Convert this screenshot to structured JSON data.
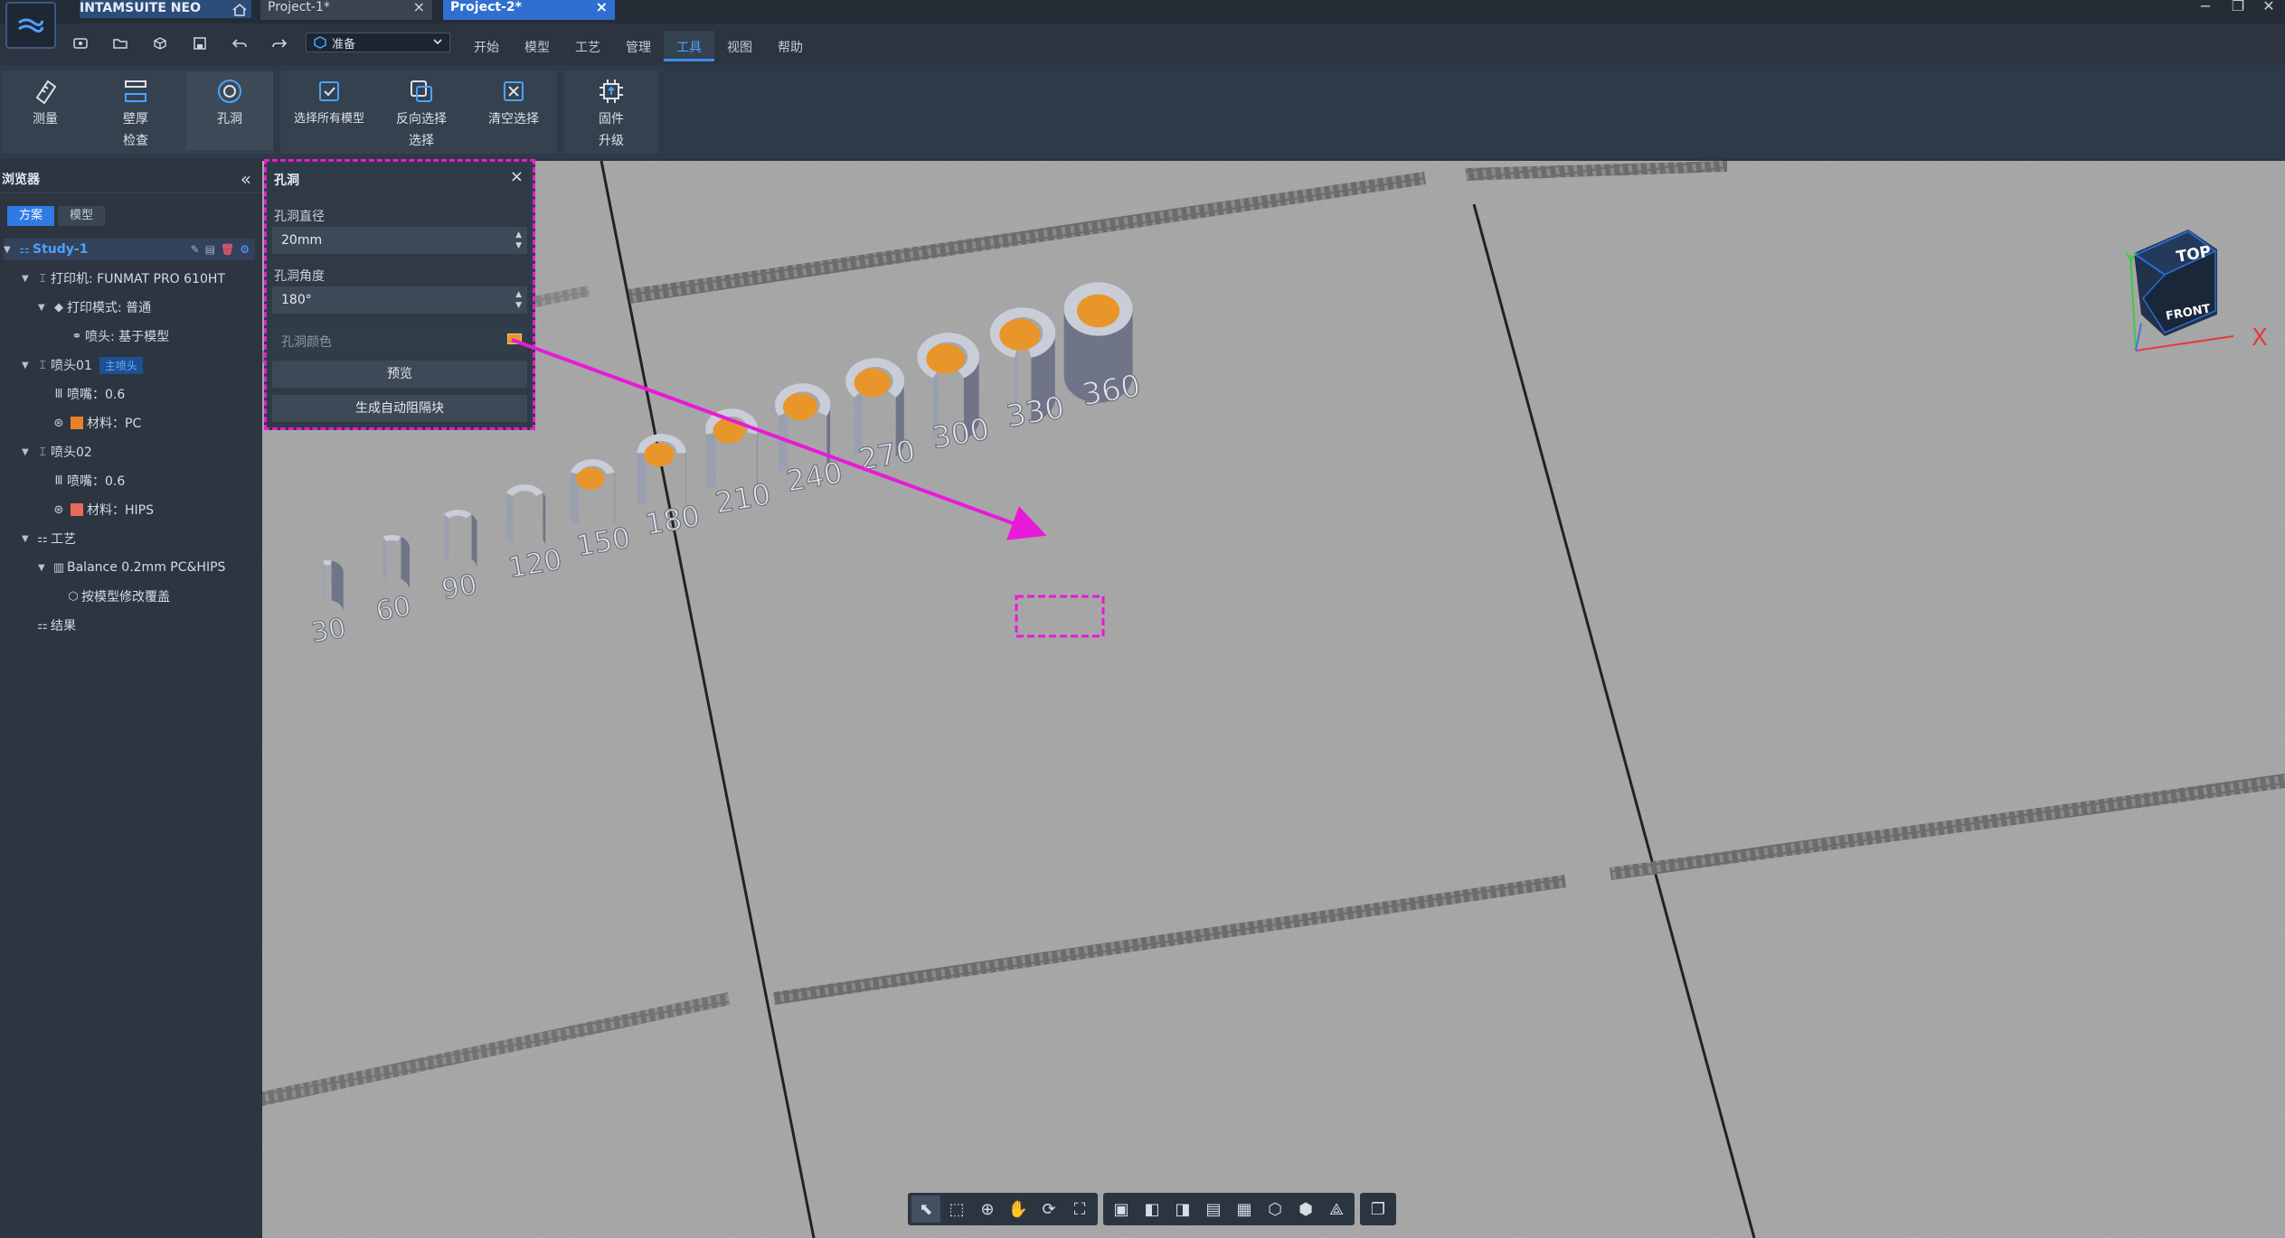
{
  "app": {
    "name": "INTAMSUITE NEO",
    "tabs": [
      {
        "label": "Project-1*",
        "active": false
      },
      {
        "label": "Project-2*",
        "active": true
      }
    ],
    "close_glyph": "×",
    "window_controls": [
      "−",
      "❐",
      "✕"
    ]
  },
  "quickbar": {
    "mode": "准备"
  },
  "menu": {
    "items": [
      "开始",
      "模型",
      "工艺",
      "管理",
      "工具",
      "视图",
      "帮助"
    ],
    "active": "工具"
  },
  "ribbon": {
    "buttons": [
      {
        "label": "测量",
        "icon": "measure-icon"
      },
      {
        "label": "壁厚\n检查",
        "icon": "wall-thickness-icon"
      },
      {
        "label": "孔洞",
        "icon": "hole-icon",
        "active": true
      },
      {
        "label": "选择所有模型",
        "icon": "select-all-icon"
      },
      {
        "label": "反向选择\n选择",
        "icon": "invert-selection-icon"
      },
      {
        "label": "清空选择",
        "icon": "clear-selection-icon"
      },
      {
        "label": "固件\n升级",
        "icon": "firmware-upgrade-icon"
      }
    ]
  },
  "sidebar": {
    "title": "浏览器",
    "tabs": [
      "方案",
      "模型"
    ],
    "active_tab": "方案",
    "tree": {
      "study": "Study-1",
      "printer": "打印机: FUNMAT PRO 610HT",
      "print_mode": "打印模式: 普通",
      "nozzle_head": "喷头: 基于模型",
      "head1": "喷头01",
      "head1_badge": "主喷头",
      "head1_nozzle": "喷嘴：0.6",
      "head1_material": "材料：PC",
      "head1_material_color": "#e8812a",
      "head2": "喷头02",
      "head2_nozzle": "喷嘴：0.6",
      "head2_material": "材料：HIPS",
      "head2_material_color": "#e86a5a",
      "process": "工艺",
      "profile": "Balance 0.2mm PC&HIPS",
      "override": "按模型修改覆盖",
      "result": "结果"
    }
  },
  "hole_panel": {
    "title": "孔洞",
    "diameter_label": "孔洞直径",
    "diameter_value": "20mm",
    "angle_label": "孔洞角度",
    "angle_value": "180°",
    "color_label": "孔洞颜色",
    "color": "#e8962a",
    "preview_button": "预览",
    "generate_button": "生成自动阻隔块"
  },
  "viewcube": {
    "top": "TOP",
    "front": "FRONT",
    "x_axis": "X",
    "y_axis": "Y"
  },
  "scene": {
    "labels": [
      "30",
      "60",
      "90",
      "120",
      "150",
      "180",
      "210",
      "240",
      "270",
      "300",
      "330",
      "360"
    ],
    "highlighted": "180",
    "hole_color": "#e8962a",
    "annotation_color": "#e81ad8"
  },
  "bottom_toolbar": {
    "group1": [
      "select-icon",
      "zoom-window-icon",
      "zoom-icon",
      "pan-icon",
      "rotate-icon",
      "fit-icon"
    ],
    "group2": [
      "view-front-icon",
      "view-left-icon",
      "view-right-icon",
      "view-bottom-icon",
      "view-back-icon",
      "view-iso-icon",
      "view-iso2-icon",
      "view-perspective-icon"
    ],
    "group3": [
      "display-mode-icon"
    ]
  }
}
